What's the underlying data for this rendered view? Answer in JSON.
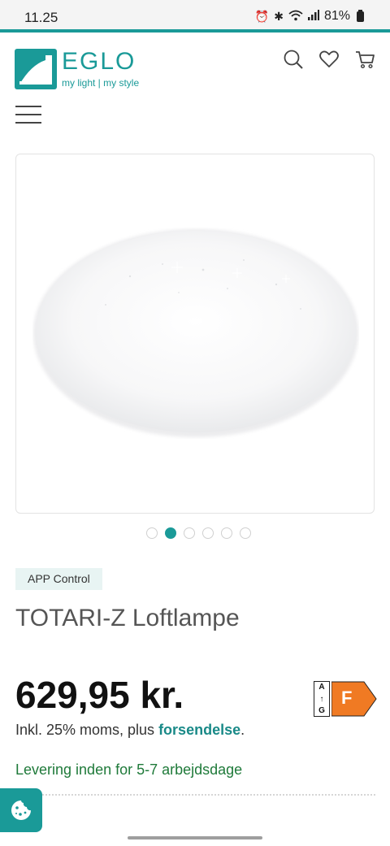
{
  "status_bar": {
    "time": "11.25",
    "battery_percent": "81%",
    "icons": [
      "alarm-icon",
      "bluetooth-icon",
      "wifi-icon",
      "signal-icon",
      "battery-icon"
    ]
  },
  "header": {
    "logo_word": "EGLO",
    "logo_tagline": "my light | my style",
    "icons": [
      "search-icon",
      "heart-icon",
      "cart-icon"
    ]
  },
  "gallery": {
    "dot_count": 6,
    "active_dot": 2
  },
  "product": {
    "badge": "APP Control",
    "title": "TOTARI-Z Loftlampe",
    "price": "629,95 kr.",
    "tax_prefix": "Inkl. 25% moms, plus ",
    "tax_link": "forsendelse",
    "tax_suffix": ".",
    "delivery": "Levering inden for 5-7 arbejdsdage",
    "energy": {
      "scale_top": "A",
      "scale_bottom": "G",
      "class": "F",
      "class_color": "#f07a23"
    }
  },
  "colors": {
    "brand": "#1a9a98",
    "delivery_green": "#1f7a3a"
  }
}
